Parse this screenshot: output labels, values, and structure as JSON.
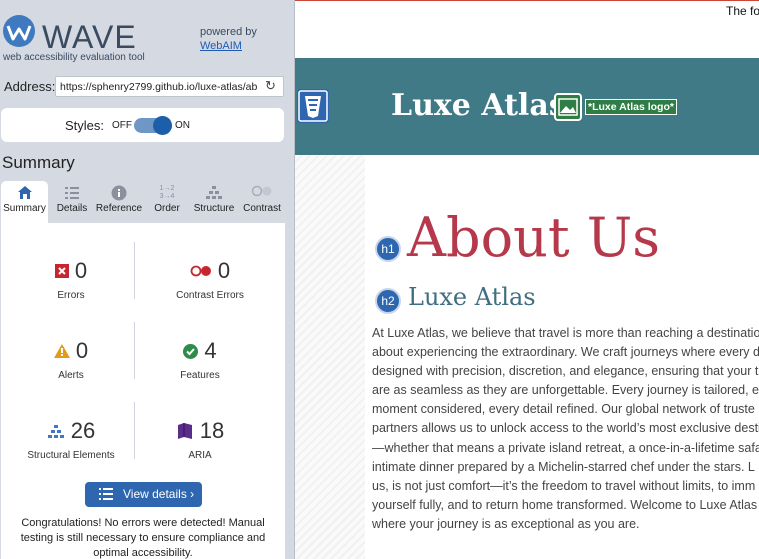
{
  "wave": {
    "title": "WAVE",
    "subtitle": "web accessibility evaluation tool",
    "powered_by": "powered by",
    "webaim": "WebAIM",
    "address_label": "Address:",
    "address_value": "https://sphenry2799.github.io/luxe-atlas/ab",
    "styles_label": "Styles:",
    "styles_off": "OFF",
    "styles_on": "ON",
    "summary_heading": "Summary",
    "tabs": [
      {
        "label": "Summary",
        "icon": "home-icon"
      },
      {
        "label": "Details",
        "icon": "list-icon"
      },
      {
        "label": "Reference",
        "icon": "info-icon"
      },
      {
        "label": "Order",
        "icon": "order-icon"
      },
      {
        "label": "Structure",
        "icon": "structure-icon"
      },
      {
        "label": "Contrast",
        "icon": "contrast-icon"
      }
    ],
    "stats": {
      "errors": {
        "value": "0",
        "label": "Errors"
      },
      "contrast_errors": {
        "value": "0",
        "label": "Contrast Errors"
      },
      "alerts": {
        "value": "0",
        "label": "Alerts"
      },
      "features": {
        "value": "4",
        "label": "Features"
      },
      "structural": {
        "value": "26",
        "label": "Structural Elements"
      },
      "aria": {
        "value": "18",
        "label": "ARIA"
      }
    },
    "view_details": "View details ›",
    "congrats": "Congratulations! No errors were detected! Manual testing is still necessary to ensure compliance and optimal accessibility."
  },
  "page": {
    "top_text": "The fo",
    "brand": "Luxe Atlas",
    "logo_alt": "*Luxe Atlas logo*",
    "h1_badge": "h1",
    "h1": "About Us",
    "h2_badge": "h2",
    "h2": "Luxe Atlas",
    "body_lines": [
      "At Luxe Atlas, we believe that travel is more than reaching a destinatio",
      "about experiencing the extraordinary. We craft journeys where every d",
      "designed with precision, discretion, and elegance, ensuring that your t",
      "are as seamless as they are unforgettable. Every journey is tailored, ev",
      "moment considered, every detail refined. Our global network of truste",
      "partners allows us to unlock access to the world’s most exclusive desti",
      "—whether that means a private island retreat, a once-in-a-lifetime safa",
      "intimate dinner prepared by a Michelin-starred chef under the stars. L",
      "us, is not just comfort—it’s the freedom to travel without limits, to imm",
      "yourself fully, and to return home transformed. Welcome to Luxe Atlas",
      "where your journey is as exceptional as you are."
    ]
  },
  "colors": {
    "header_teal": "#3f7a86",
    "heading_red": "#b5384b",
    "wave_blue": "#2e67b0"
  }
}
